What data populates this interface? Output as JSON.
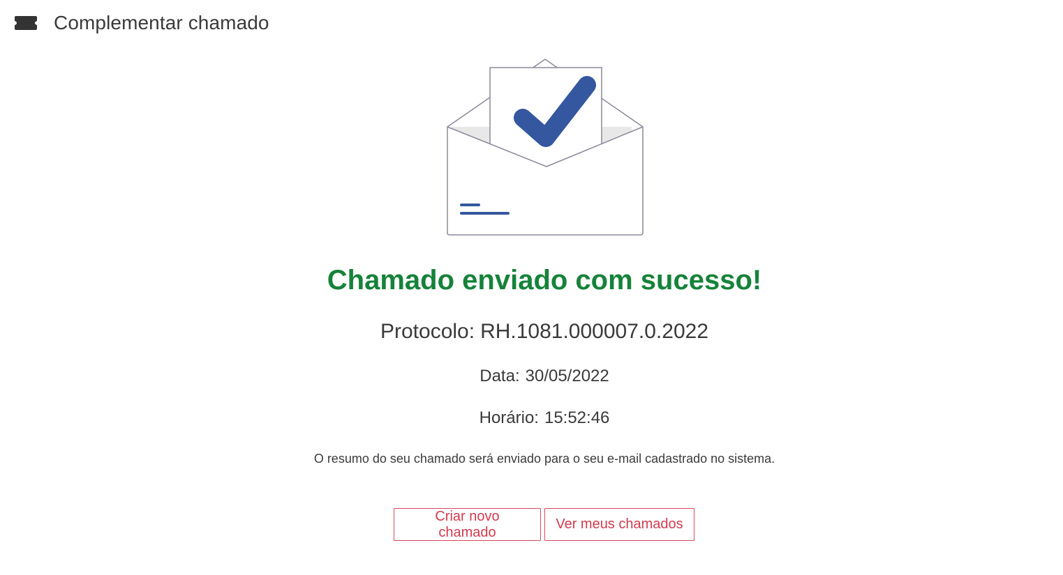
{
  "header": {
    "icon": "ticket-icon",
    "title": "Complementar chamado"
  },
  "illustration": {
    "icon": "envelope-check-icon",
    "accent_color": "#3557a0",
    "outline_color": "#8a8a9a"
  },
  "result": {
    "title": "Chamado enviado com sucesso!",
    "title_color": "#16823a",
    "protocol_label": "Protocolo:",
    "protocol_value": "RH.1081.000007.0.2022",
    "date_label": "Data:",
    "date_value": "30/05/2022",
    "time_label": "Horário:",
    "time_value": "15:52:46",
    "summary": "O resumo do seu chamado será enviado para o seu e-mail cadastrado no sistema."
  },
  "actions": {
    "new_ticket_label": "Criar novo chamado",
    "my_tickets_label": "Ver meus chamados",
    "button_color": "#d33a4e"
  }
}
